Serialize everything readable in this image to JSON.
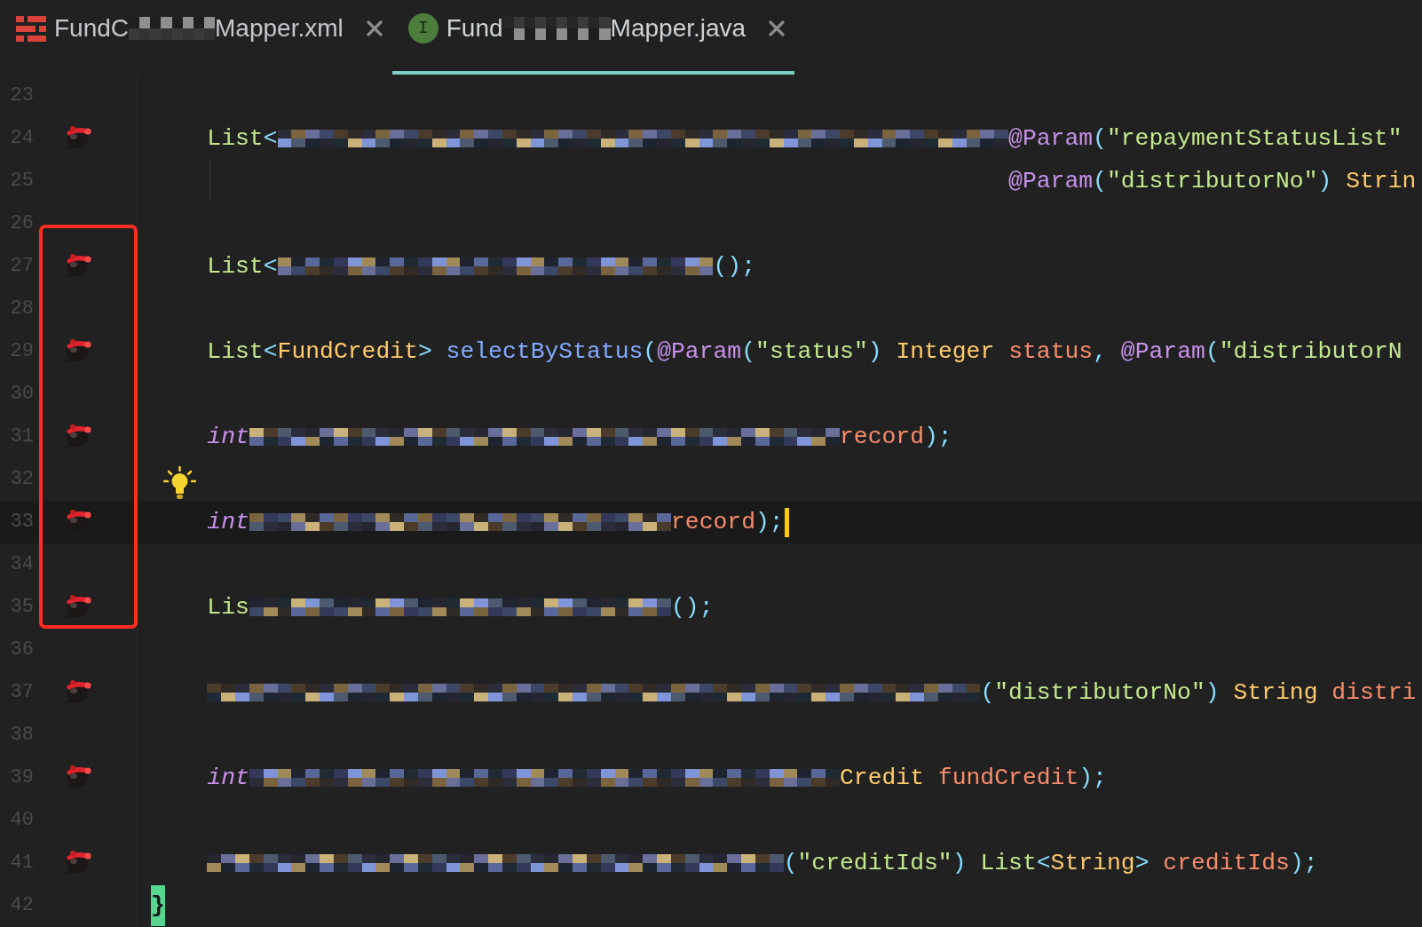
{
  "tabs": [
    {
      "kind": "xml",
      "label_parts": [
        "FundC",
        "Mapper.xml"
      ],
      "selected": false
    },
    {
      "kind": "interface",
      "badge": "I",
      "label_parts": [
        "Fund",
        "Mapper.java"
      ],
      "selected": true
    }
  ],
  "lines": [
    {
      "number": "23",
      "marker": false,
      "bulb": false,
      "current": false
    },
    {
      "number": "24",
      "kind": "code",
      "marker": true,
      "bulb": false,
      "current": false,
      "segments": [
        {
          "kind": "code",
          "parts": [
            {
              "text": "List",
              "kind": "class"
            },
            {
              "text": "<",
              "kind": "punct"
            }
          ]
        },
        {
          "kind": "mosaic"
        },
        {
          "kind": "code",
          "parts": [
            {
              "text": "@Param",
              "kind": "annotation"
            },
            {
              "text": "(",
              "kind": "punct"
            },
            {
              "text": "\"repaymentStatusList\"",
              "kind": "string"
            }
          ]
        }
      ]
    },
    {
      "number": "25",
      "kind": "continuation",
      "marker": false,
      "bulb": false,
      "current": false,
      "segments": [
        {
          "kind": "code",
          "parts": [
            {
              "text": "@Param",
              "kind": "annotation"
            },
            {
              "text": "(",
              "kind": "punct"
            },
            {
              "text": "\"distributorNo\"",
              "kind": "string"
            },
            {
              "text": ") ",
              "kind": "punct"
            },
            {
              "text": "Strin",
              "kind": "type"
            }
          ]
        }
      ]
    },
    {
      "number": "26",
      "marker": false,
      "bulb": false,
      "current": false
    },
    {
      "kind": "frame",
      "lines": [
        {
          "number": "27",
          "kind": "code",
          "marker": true,
          "bulb": false,
          "current": false,
          "segments": [
            {
              "kind": "code",
              "parts": [
                {
                  "text": "List",
                  "kind": "class"
                },
                {
                  "text": "<",
                  "kind": "punct"
                }
              ]
            },
            {
              "kind": "mosaic"
            },
            {
              "kind": "code",
              "parts": [
                {
                  "text": "();",
                  "kind": "punct"
                }
              ]
            }
          ]
        },
        {
          "number": "28",
          "marker": false,
          "bulb": false,
          "current": false
        },
        {
          "number": "29",
          "kind": "code",
          "marker": true,
          "bulb": false,
          "current": false,
          "segments": [
            {
              "kind": "code",
              "parts": [
                {
                  "text": "List",
                  "kind": "class"
                },
                {
                  "text": "<",
                  "kind": "punct"
                },
                {
                  "text": "FundCredit",
                  "kind": "type"
                },
                {
                  "text": "> ",
                  "kind": "punct"
                },
                {
                  "text": "selectByStatus",
                  "kind": "method"
                },
                {
                  "text": "(",
                  "kind": "punct"
                },
                {
                  "text": "@Param",
                  "kind": "annotation"
                },
                {
                  "text": "(",
                  "kind": "punct"
                },
                {
                  "text": "\"status\"",
                  "kind": "string"
                },
                {
                  "text": ") ",
                  "kind": "punct"
                },
                {
                  "text": "Integer ",
                  "kind": "type"
                },
                {
                  "text": "status",
                  "kind": "param"
                },
                {
                  "text": ", ",
                  "kind": "punct"
                },
                {
                  "text": "@Param",
                  "kind": "annotation"
                },
                {
                  "text": "(",
                  "kind": "punct"
                },
                {
                  "text": "\"distributorN",
                  "kind": "string"
                }
              ]
            }
          ]
        },
        {
          "number": "30",
          "marker": false,
          "bulb": false,
          "current": false
        },
        {
          "number": "31",
          "kind": "code",
          "marker": true,
          "bulb": false,
          "current": false,
          "segments": [
            {
              "kind": "code",
              "parts": [
                {
                  "text": "int",
                  "kind": "keyword"
                }
              ]
            },
            {
              "kind": "mosaic"
            },
            {
              "kind": "code",
              "parts": [
                {
                  "text": "record",
                  "kind": "param"
                },
                {
                  "text": ");",
                  "kind": "punct"
                }
              ]
            }
          ]
        },
        {
          "number": "32",
          "marker": false,
          "bulb": true,
          "current": false
        },
        {
          "number": "33",
          "kind": "code",
          "marker": true,
          "bulb": false,
          "current": true,
          "segments": [
            {
              "kind": "code",
              "parts": [
                {
                  "text": "int",
                  "kind": "keyword"
                }
              ]
            },
            {
              "kind": "mosaic"
            },
            {
              "kind": "code",
              "parts": [
                {
                  "text": "record",
                  "kind": "param"
                },
                {
                  "text": ");",
                  "kind": "punct"
                }
              ]
            }
          ]
        },
        {
          "number": "34",
          "marker": false,
          "bulb": false,
          "current": false
        },
        {
          "number": "35",
          "kind": "code",
          "marker": true,
          "bulb": false,
          "current": false,
          "segments": [
            {
              "kind": "code",
              "parts": [
                {
                  "text": "Lis",
                  "kind": "class"
                }
              ]
            },
            {
              "kind": "mosaic"
            },
            {
              "kind": "code",
              "parts": [
                {
                  "text": "();",
                  "kind": "punct"
                }
              ]
            }
          ]
        }
      ]
    },
    {
      "number": "36",
      "marker": false,
      "bulb": false,
      "current": false
    },
    {
      "number": "37",
      "kind": "code",
      "marker": true,
      "bulb": false,
      "current": false,
      "segments": [
        {
          "kind": "mosaic"
        },
        {
          "kind": "code",
          "parts": [
            {
              "text": "(",
              "kind": "punct"
            },
            {
              "text": "\"distributorNo\"",
              "kind": "string"
            },
            {
              "text": ") ",
              "kind": "punct"
            },
            {
              "text": "String ",
              "kind": "type"
            },
            {
              "text": "distri",
              "kind": "param"
            }
          ]
        }
      ]
    },
    {
      "number": "38",
      "marker": false,
      "bulb": false,
      "current": false
    },
    {
      "number": "39",
      "kind": "code",
      "marker": true,
      "bulb": false,
      "current": false,
      "segments": [
        {
          "kind": "code",
          "parts": [
            {
              "text": "int",
              "kind": "keyword"
            }
          ]
        },
        {
          "kind": "mosaic"
        },
        {
          "kind": "code",
          "parts": [
            {
              "text": "Credit ",
              "kind": "type"
            },
            {
              "text": "fundCredit",
              "kind": "param"
            },
            {
              "text": ");",
              "kind": "punct"
            }
          ]
        }
      ]
    },
    {
      "number": "40",
      "marker": false,
      "bulb": false,
      "current": false
    },
    {
      "number": "41",
      "kind": "code",
      "marker": true,
      "bulb": false,
      "current": false,
      "segments": [
        {
          "kind": "mosaic"
        },
        {
          "kind": "code",
          "parts": [
            {
              "text": "(",
              "kind": "punct"
            },
            {
              "text": "\"creditIds\"",
              "kind": "string"
            },
            {
              "text": ") ",
              "kind": "punct"
            },
            {
              "text": "List",
              "kind": "class"
            },
            {
              "text": "<",
              "kind": "punct"
            },
            {
              "text": "String",
              "kind": "type"
            },
            {
              "text": "> ",
              "kind": "punct"
            },
            {
              "text": "creditIds",
              "kind": "param"
            },
            {
              "text": ");",
              "kind": "punct"
            }
          ]
        }
      ]
    },
    {
      "number": "42",
      "kind": "close",
      "marker": false,
      "bulb": false,
      "current": false,
      "segments": [
        {
          "kind": "code",
          "parts": [
            {
              "text": "}",
              "kind": "brace"
            }
          ]
        }
      ]
    }
  ]
}
